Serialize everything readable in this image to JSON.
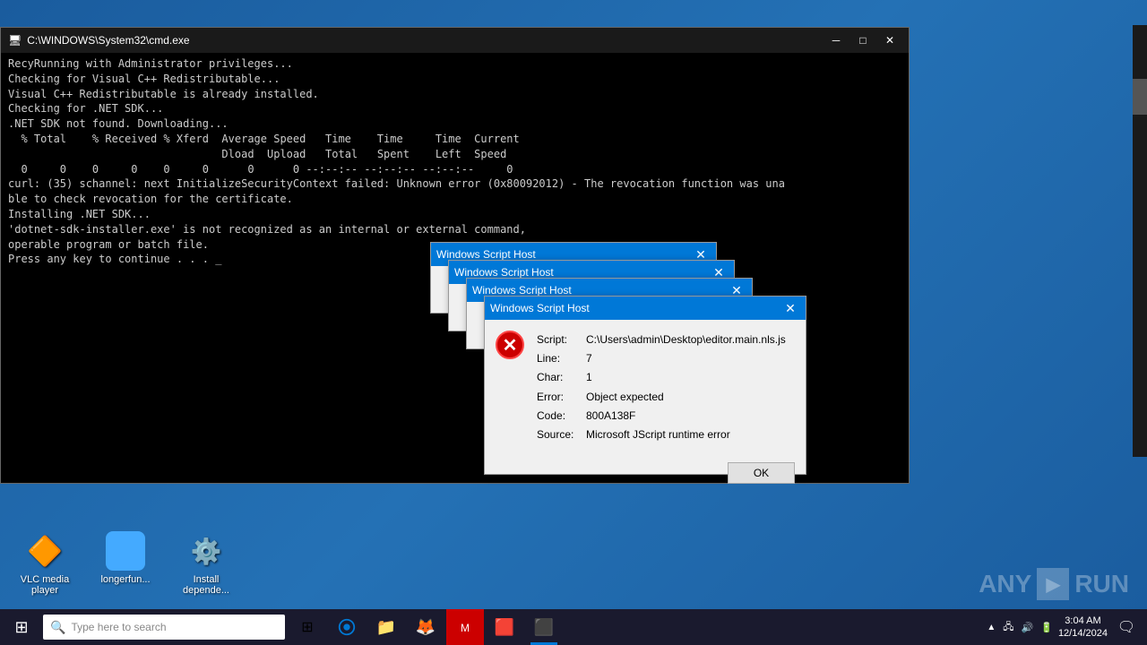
{
  "desktop": {
    "background_color": "#1a5c9e"
  },
  "cmd_window": {
    "title": "C:\\WINDOWS\\System32\\cmd.exe",
    "title_icon": "🖥",
    "content": "RecyRunning with Administrator privileges...\nChecking for Visual C++ Redistributable...\nVisual C++ Redistributable is already installed.\nChecking for .NET SDK...\n.NET SDK not found. Downloading...\n  % Total    % Received % Xferd  Average Speed   Time    Time     Time  Current\n                                 Dload  Upload   Total   Spent    Left  Speed\n  0     0    0     0    0     0      0      0 --:--:-- --:--:-- --:--:--     0\ncurl: (35) schannel: next InitializeSecurityContext failed: Unknown error (0x80092012) - The revocation function was una\nble to check revocation for the certificate.\nInstalling .NET SDK...\n'dotnet-sdk-installer.exe' is not recognized as an internal or external command,\noperable program or batch file.\nPress any key to continue . . . _"
  },
  "wsh_dialogs": [
    {
      "id": "dialog1",
      "title": "Windows Script Host"
    },
    {
      "id": "dialog2",
      "title": "Windows Script Host"
    },
    {
      "id": "dialog3",
      "title": "Windows Script Host"
    },
    {
      "id": "dialog4",
      "title": "Windows Script Host",
      "error": {
        "script": "C:\\Users\\admin\\Desktop\\editor.main.nls.js",
        "line": "7",
        "char": "1",
        "error_msg": "Object expected",
        "code": "800A138F",
        "source": "Microsoft JScript runtime error"
      },
      "ok_label": "OK"
    }
  ],
  "taskbar": {
    "search_placeholder": "Type here to search",
    "apps": [
      {
        "name": "task-view",
        "icon": "⊞"
      },
      {
        "name": "edge",
        "icon": "🌐"
      },
      {
        "name": "file-explorer",
        "icon": "📁"
      },
      {
        "name": "firefox",
        "icon": "🦊"
      },
      {
        "name": "app5",
        "icon": "🔴"
      },
      {
        "name": "app6",
        "icon": "🎮"
      },
      {
        "name": "terminal",
        "icon": "⬛"
      }
    ],
    "clock": {
      "time": "3:04 AM",
      "date": "12/14/2024"
    }
  },
  "bottom_icons": [
    {
      "name": "vlc",
      "label": "VLC media player",
      "color": "#f80"
    },
    {
      "name": "longerfun",
      "label": "longerfun...",
      "color": "#4af"
    },
    {
      "name": "install-deps",
      "label": "Install depende...",
      "color": "#888"
    }
  ],
  "watermark": {
    "text": "ANY▶RUN"
  }
}
